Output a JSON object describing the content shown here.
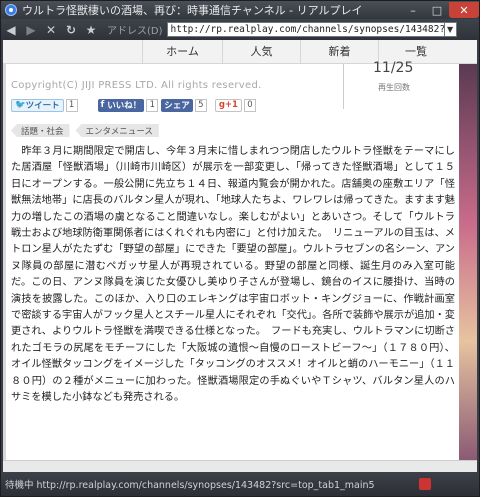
{
  "window": {
    "title": "ウルトラ怪獣棲いの酒場、再び：時事通信チャンネル - リアルプレイ"
  },
  "toolbar": {
    "address_label": "アドレス(D)",
    "url": "http://rp.realplay.com/channels/synopses/143482?src=top_tab1_main5"
  },
  "nav": {
    "items": [
      "ホーム",
      "人気",
      "新着",
      "一覧"
    ]
  },
  "header": {
    "copyright": "Copyright(C) JIJI PRESS LTD. All rights reserved.",
    "date_fragment": "11/25",
    "plays_label": "再生回数"
  },
  "share": {
    "tweet_label": "ツイート",
    "tweet_count": "1",
    "like_label": "いいね！",
    "like_count": "1",
    "share_label": "シェア",
    "share_count": "5",
    "gplus_label": "g+1",
    "gplus_count": "0"
  },
  "tags": [
    "話題・社会",
    "エンタメニュース"
  ],
  "article": {
    "body": "　昨年３月に期間限定で開店し、今年３月末に惜しまれつつ閉店したウルトラ怪獣をテーマにした居酒屋「怪獣酒場」（川崎市川崎区）が展示を一部変更し、「帰ってきた怪獣酒場」として１５日にオープンする。一般公開に先立ち１４日、報道内覧会が開かれた。店舗奥の座敷エリア「怪獣無法地帯」に店長のバルタン星人が現れ、「地球人たちよ、ワレワレは帰ってきた。ますます魅力の増したこの酒場の虜となること間違いなし。楽しむがよい」とあいさつ。そして「ウルトラ戦士および地球防衛軍関係者にはくれぐれも内密に」と付け加えた。　リニューアルの目玉は、メトロン星人がたたずむ「野望の部屋」にできた「要望の部屋」。ウルトラセブンの名シーン、アンヌ隊員の部屋に潜むペガッサ星人が再現されている。野望の部屋と同様、誕生月のみ入室可能だ。この日、アンヌ隊員を演じた女優ひし美ゆり子さんが登場し、鏡台のイスに腰掛け、当時の演技を披露した。このほか、入り口のエレキングは宇宙ロボット・キングジョーに、作戦計画室で密談する宇宙人がフック星人とスチール星人にそれぞれ「交代」。各所で装飾や展示が追加・変更され、よりウルトラ怪獣を満喫できる仕様となった。　フードも充実し、ウルトラマンに切断されたゴモラの尻尾をモチーフにした「大阪城の遺恨～自慢のローストビーフ～」（１７８０円）、オイル怪獣タッコングをイメージした「タッコングのオススメ！オイルと蛸のハーモニー」（１１８０円）の２種がメニューに加わった。怪獣酒場限定の手ぬぐいやＴシャツ、バルタン星人のハサミを模した小鉢なども発売される。"
  },
  "statusbar": {
    "text": "待機中 http://rp.realplay.com/channels/synopses/143482?src=top_tab1_main5"
  }
}
